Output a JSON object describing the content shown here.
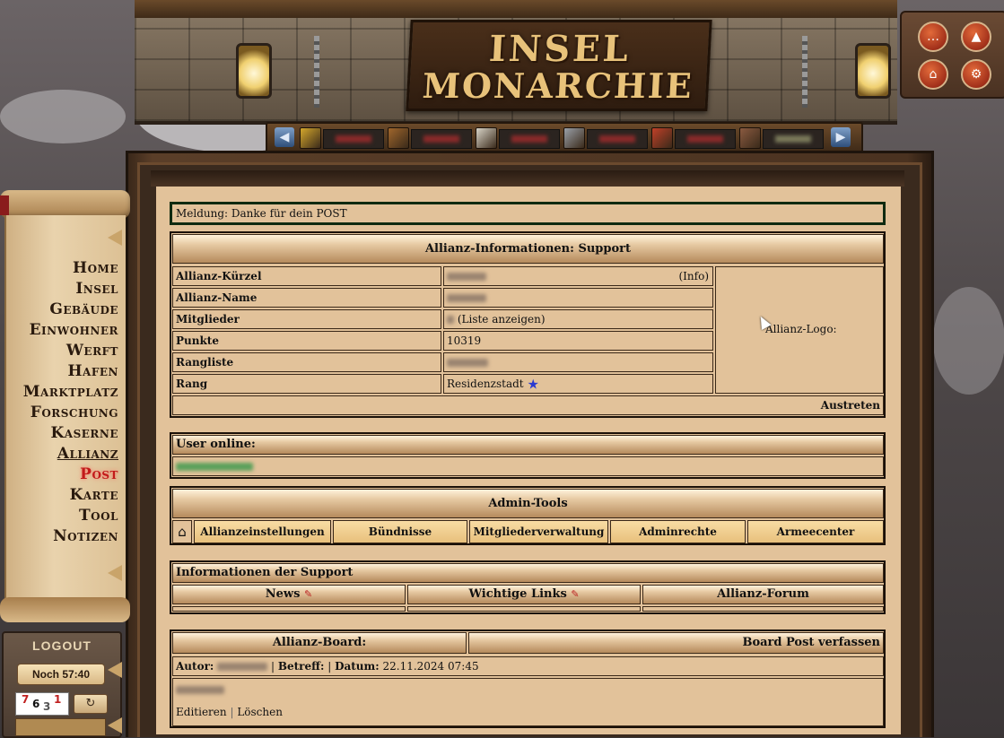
{
  "header": {
    "logo_line1": "INSEL",
    "logo_line2": "MONARCHIE"
  },
  "resources": {
    "prev_icon": "arrow-left-icon",
    "next_icon": "arrow-right-icon",
    "items": [
      {
        "icon": "gold-icon",
        "color": "#d4a72c"
      },
      {
        "icon": "wood-icon",
        "color": "#a0662c"
      },
      {
        "icon": "stone-icon",
        "color": "#d8d4c8"
      },
      {
        "icon": "iron-icon",
        "color": "#9aa0a8"
      },
      {
        "icon": "food-icon",
        "color": "#c04028"
      },
      {
        "icon": "population-icon",
        "color": "#8a5a40"
      }
    ]
  },
  "top_right_buttons": [
    "chat-icon",
    "ranking-icon",
    "bank-icon",
    "settings-icon"
  ],
  "menu": {
    "items": [
      "Home",
      "Insel",
      "Gebäude",
      "Einwohner",
      "Werft",
      "Hafen",
      "Marktplatz",
      "Forschung",
      "Kaserne",
      "Allianz",
      "Post",
      "Karte",
      "Tool",
      "Notizen"
    ],
    "active": "Post",
    "underlined": "Allianz"
  },
  "session": {
    "logout_label": "LOGOUT",
    "timer": "Noch 57:40",
    "captcha_digits": [
      {
        "d": "7",
        "c": "#c02020"
      },
      {
        "d": "6",
        "c": "#111"
      },
      {
        "d": "3",
        "c": "#555"
      },
      {
        "d": "1",
        "c": "#c02020"
      }
    ],
    "refresh_icon": "refresh-icon"
  },
  "message": "Meldung: Danke für dein POST",
  "alliance_info": {
    "title": "Allianz-Informationen: Support",
    "rows": [
      {
        "label": "Allianz-Kürzel",
        "suffix": "(Info)"
      },
      {
        "label": "Allianz-Name",
        "suffix": ""
      },
      {
        "label": "Mitglieder",
        "suffix": "(Liste anzeigen)"
      },
      {
        "label": "Punkte",
        "value": "10319"
      },
      {
        "label": "Rangliste",
        "suffix": ""
      },
      {
        "label": "Rang",
        "value": "Residenzstadt"
      }
    ],
    "logo_label": "Allianz-Logo:",
    "leave": "Austreten"
  },
  "online": {
    "title": "User online:"
  },
  "admin": {
    "title": "Admin-Tools",
    "home_icon": "home-icon",
    "buttons": [
      "Allianzeinstellungen",
      "Bündnisse",
      "Mitgliederverwaltung",
      "Adminrechte",
      "Armeecenter"
    ]
  },
  "info": {
    "title": "Informationen der Support",
    "cols": [
      "News",
      "Wichtige Links",
      "Allianz-Forum"
    ]
  },
  "board": {
    "title": "Allianz-Board:",
    "compose": "Board Post verfassen",
    "autor_label": "Autor:",
    "betreff_label": "Betreff:",
    "datum_label": "Datum:",
    "datum": "22.11.2024 07:45",
    "edit": "Editieren",
    "sep": "|",
    "delete": "Löschen"
  }
}
